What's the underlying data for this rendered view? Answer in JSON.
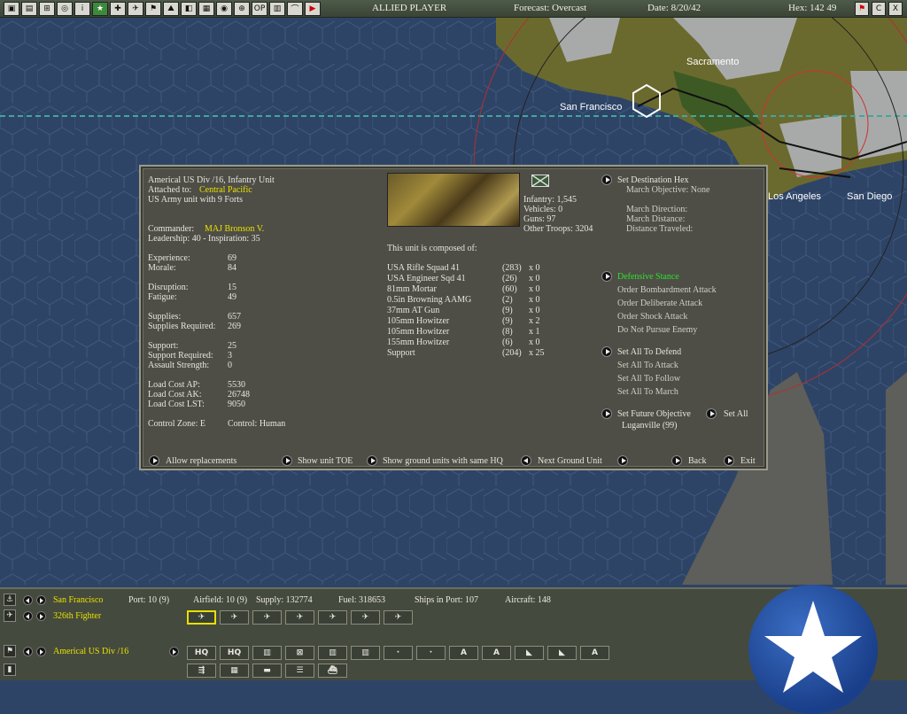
{
  "topbar": {
    "side": "ALLIED PLAYER",
    "forecast": "Forecast: Overcast",
    "date": "Date: 8/20/42",
    "hex": "Hex: 142 49",
    "icons": [
      "save-icon",
      "report-icon",
      "settings-icon",
      "binoculars-icon",
      "info-icon",
      "star-icon",
      "aircraft-icon",
      "fighter-icon",
      "flag-icon",
      "ship-icon",
      "map-icon",
      "base-icon",
      "globe-icon",
      "search-icon",
      "op-icon",
      "grid-icon",
      "sound-icon",
      "end-turn-icon"
    ],
    "right_icons": [
      "flag-icon",
      "close-c-icon",
      "exit-x-icon"
    ]
  },
  "map": {
    "labels": [
      "Sacramento",
      "San Francisco",
      "Los Angeles",
      "San Diego"
    ]
  },
  "unit": {
    "name": "Americal US Div /16, Infantry Unit",
    "attached_label": "Attached to:",
    "attached_value": "Central Pacific",
    "forts": "US Army unit with 9 Forts",
    "commander_label": "Commander:",
    "commander_value": "MAJ Bronson V.",
    "leadership": "Leadership: 40 - Inspiration: 35",
    "stats": [
      {
        "label": "Experience:",
        "value": "69"
      },
      {
        "label": "Morale:",
        "value": "84"
      },
      {
        "label": "Disruption:",
        "value": "15"
      },
      {
        "label": "Fatigue:",
        "value": "49"
      },
      {
        "label": "Supplies:",
        "value": "657"
      },
      {
        "label": "Supplies Required:",
        "value": "269"
      },
      {
        "label": "Support:",
        "value": "25"
      },
      {
        "label": "Support Required:",
        "value": "3"
      },
      {
        "label": "Assault Strength:",
        "value": "0"
      },
      {
        "label": "Load Cost AP:",
        "value": "5530"
      },
      {
        "label": "Load Cost AK:",
        "value": "26748"
      },
      {
        "label": "Load Cost LST:",
        "value": "9050"
      }
    ],
    "control_zone": "Control Zone: E",
    "control": "Control: Human",
    "troops": {
      "infantry": "Infantry: 1,545",
      "vehicles": "Vehicles: 0",
      "guns": "Guns: 97",
      "other": "Other Troops: 3204"
    },
    "composed_title": "This unit is composed of:",
    "composition": [
      {
        "name": "USA Rifle Squad 41",
        "count": "(283)",
        "x": "x  0"
      },
      {
        "name": "USA Engineer Sqd 41",
        "count": "(26)",
        "x": "x  0"
      },
      {
        "name": "81mm Mortar",
        "count": "(60)",
        "x": "x  0"
      },
      {
        "name": "0.5in Browning AAMG",
        "count": "(2)",
        "x": "x  0"
      },
      {
        "name": "37mm AT Gun",
        "count": "(9)",
        "x": "x  0"
      },
      {
        "name": "105mm Howitzer",
        "count": "(9)",
        "x": "x  2"
      },
      {
        "name": "105mm Howitzer",
        "count": "(8)",
        "x": "x  1"
      },
      {
        "name": "155mm Howitzer",
        "count": "(6)",
        "x": "x  0"
      },
      {
        "name": "Support",
        "count": "(204)",
        "x": "x  25"
      }
    ],
    "destination": {
      "button": "Set Destination Hex",
      "objective": "March Objective: None",
      "direction": "March Direction:",
      "distance": "March Distance:",
      "traveled": "Distance Traveled:"
    },
    "stances": [
      "Defensive Stance",
      "Order Bombardment Attack",
      "Order Deliberate Attack",
      "Order Shock Attack",
      "Do Not Pursue Enemy"
    ],
    "set_all": {
      "defend": "Set All To Defend",
      "attack": "Set All To Attack",
      "follow": "Set All To Follow",
      "march": "Set All To March"
    },
    "future_objective": "Set Future Objective",
    "set_all_btn": "Set All",
    "future_target": "Luganville (99)",
    "footer": {
      "replacements": "Allow replacements",
      "toe": "Show unit TOE",
      "same_hq": "Show ground units with same HQ",
      "next": "Next Ground Unit",
      "back": "Back",
      "exit": "Exit"
    }
  },
  "bottom": {
    "base": "San Francisco",
    "port": "Port: 10 (9)",
    "airfield": "Airfield: 10 (9)",
    "supply": "Supply: 132774",
    "fuel": "Fuel: 318653",
    "ships": "Ships in Port: 107",
    "aircraft": "Aircraft: 148",
    "air_unit": "326th Fighter",
    "ground_unit": "Americal US Div /16",
    "row1": [
      "✈",
      "✈",
      "✈",
      "✈",
      "✈",
      "✈",
      "✈"
    ],
    "row2": [
      "HQ",
      "HQ",
      "▥",
      "⊠",
      "▥",
      "▥",
      "·",
      "·",
      "A",
      "A",
      "◣",
      "◣",
      "A"
    ],
    "row3": [
      "⇶",
      "▦",
      "▬",
      "☰",
      "⛴"
    ]
  },
  "colors": {
    "accent_yellow": "#e8e000",
    "stance_green": "#30e030",
    "sea": "#2e4466"
  }
}
